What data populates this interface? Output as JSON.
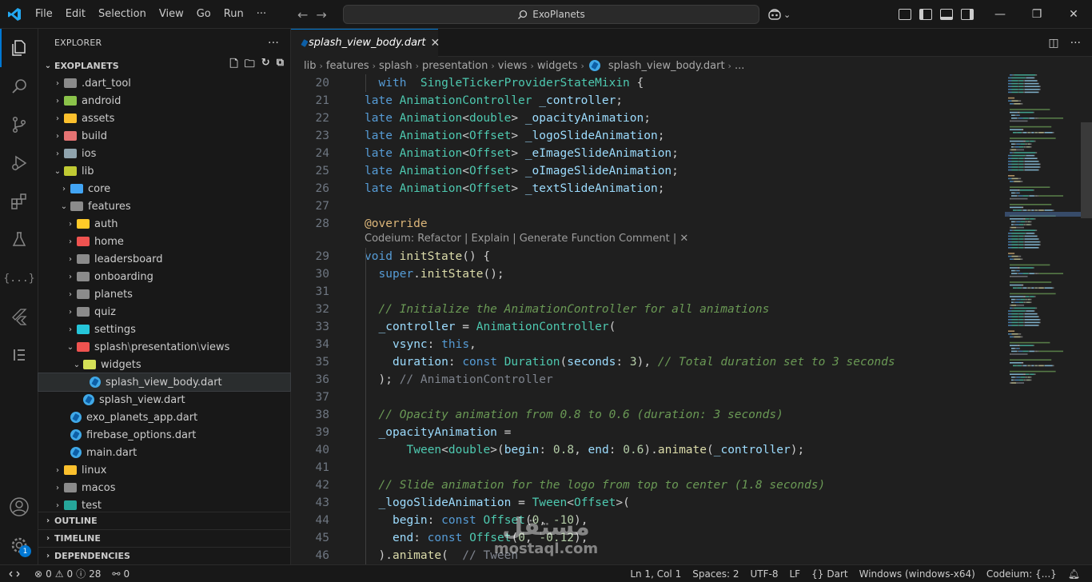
{
  "titlebar": {
    "menu": [
      "File",
      "Edit",
      "Selection",
      "View",
      "Go",
      "Run",
      "···"
    ],
    "search_text": "ExoPlanets"
  },
  "sidebar": {
    "title": "EXPLORER",
    "more": "···",
    "project": "EXOPLANETS",
    "tree": [
      {
        "label": "dart_tool",
        "prefix": ".",
        "depth": 0,
        "kind": "folder",
        "open": false,
        "color": "#8b8b8b",
        "name": "tree-folder-dart-tool"
      },
      {
        "label": "android",
        "depth": 0,
        "kind": "folder",
        "open": false,
        "color": "#8bc34a",
        "name": "tree-folder-android"
      },
      {
        "label": "assets",
        "depth": 0,
        "kind": "folder",
        "open": false,
        "color": "#fbc02d",
        "name": "tree-folder-assets"
      },
      {
        "label": "build",
        "depth": 0,
        "kind": "folder",
        "open": false,
        "color": "#e57373",
        "name": "tree-folder-build"
      },
      {
        "label": "ios",
        "depth": 0,
        "kind": "folder",
        "open": false,
        "color": "#90a4ae",
        "name": "tree-folder-ios"
      },
      {
        "label": "lib",
        "depth": 0,
        "kind": "folder",
        "open": true,
        "color": "#c0ca33",
        "name": "tree-folder-lib"
      },
      {
        "label": "core",
        "depth": 1,
        "kind": "folder",
        "open": false,
        "color": "#42a5f5",
        "name": "tree-folder-core"
      },
      {
        "label": "features",
        "depth": 1,
        "kind": "folder",
        "open": true,
        "color": "#8b8b8b",
        "name": "tree-folder-features"
      },
      {
        "label": "auth",
        "depth": 2,
        "kind": "folder",
        "open": false,
        "color": "#ffca28",
        "name": "tree-folder-auth"
      },
      {
        "label": "home",
        "depth": 2,
        "kind": "folder",
        "open": false,
        "color": "#ef5350",
        "name": "tree-folder-home"
      },
      {
        "label": "leadersboard",
        "depth": 2,
        "kind": "folder",
        "open": false,
        "color": "#8b8b8b",
        "name": "tree-folder-leadersboard"
      },
      {
        "label": "onboarding",
        "depth": 2,
        "kind": "folder",
        "open": false,
        "color": "#8b8b8b",
        "name": "tree-folder-onboarding"
      },
      {
        "label": "planets",
        "depth": 2,
        "kind": "folder",
        "open": false,
        "color": "#8b8b8b",
        "name": "tree-folder-planets"
      },
      {
        "label": "quiz",
        "depth": 2,
        "kind": "folder",
        "open": false,
        "color": "#8b8b8b",
        "name": "tree-folder-quiz"
      },
      {
        "label": "settings",
        "depth": 2,
        "kind": "folder",
        "open": false,
        "color": "#26c6da",
        "name": "tree-folder-settings"
      },
      {
        "label": "splash",
        "depth": 2,
        "kind": "folder",
        "open": true,
        "color": "#ef5350",
        "compact": [
          "presentation",
          "views"
        ],
        "name": "tree-folder-splash"
      },
      {
        "label": "widgets",
        "depth": 3,
        "kind": "folder",
        "open": true,
        "color": "#d4e157",
        "name": "tree-folder-widgets"
      },
      {
        "label": "splash_view_body.dart",
        "depth": 4,
        "kind": "dart",
        "selected": true,
        "name": "tree-file-splash-view-body"
      },
      {
        "label": "splash_view.dart",
        "depth": 3,
        "kind": "dart",
        "name": "tree-file-splash-view"
      },
      {
        "label": "exo_planets_app.dart",
        "depth": 1,
        "kind": "dart",
        "name": "tree-file-exo-planets-app"
      },
      {
        "label": "firebase_options.dart",
        "depth": 1,
        "kind": "dart",
        "name": "tree-file-firebase-options"
      },
      {
        "label": "main.dart",
        "depth": 1,
        "kind": "dart",
        "name": "tree-file-main"
      },
      {
        "label": "linux",
        "depth": 0,
        "kind": "folder",
        "open": false,
        "color": "#fbc02d",
        "name": "tree-folder-linux"
      },
      {
        "label": "macos",
        "depth": 0,
        "kind": "folder",
        "open": false,
        "color": "#8b8b8b",
        "name": "tree-folder-macos"
      },
      {
        "label": "test",
        "depth": 0,
        "kind": "folder",
        "open": false,
        "color": "#26a69a",
        "name": "tree-folder-test"
      }
    ],
    "sections": [
      "OUTLINE",
      "TIMELINE",
      "DEPENDENCIES"
    ]
  },
  "editor": {
    "tab": "splash_view_body.dart",
    "breadcrumb": [
      "lib",
      "features",
      "splash",
      "presentation",
      "views",
      "widgets",
      "splash_view_body.dart",
      "..."
    ],
    "codelens": "Codeium: Refactor | Explain | Generate Function Comment | ✕",
    "lines": [
      {
        "n": "20",
        "i": 1,
        "t": [
          [
            "kw",
            "with"
          ],
          [
            "",
            "  "
          ],
          [
            "ty",
            "SingleTickerProviderStateMixin"
          ],
          [
            "",
            " {"
          ]
        ]
      },
      {
        "n": "21",
        "i": 0,
        "t": [
          [
            "kw",
            "late "
          ],
          [
            "ty",
            "AnimationController"
          ],
          [
            "",
            " "
          ],
          [
            "va",
            "_controller"
          ],
          [
            "",
            ";"
          ]
        ]
      },
      {
        "n": "22",
        "i": 0,
        "t": [
          [
            "kw",
            "late "
          ],
          [
            "ty",
            "Animation"
          ],
          [
            "",
            "<"
          ],
          [
            "ty",
            "double"
          ],
          [
            "",
            "> "
          ],
          [
            "va",
            "_opacityAnimation"
          ],
          [
            "",
            ";"
          ]
        ]
      },
      {
        "n": "23",
        "i": 0,
        "t": [
          [
            "kw",
            "late "
          ],
          [
            "ty",
            "Animation"
          ],
          [
            "",
            "<"
          ],
          [
            "ty",
            "Offset"
          ],
          [
            "",
            "> "
          ],
          [
            "va",
            "_logoSlideAnimation"
          ],
          [
            "",
            ";"
          ]
        ]
      },
      {
        "n": "24",
        "i": 0,
        "t": [
          [
            "kw",
            "late "
          ],
          [
            "ty",
            "Animation"
          ],
          [
            "",
            "<"
          ],
          [
            "ty",
            "Offset"
          ],
          [
            "",
            "> "
          ],
          [
            "va",
            "_eImageSlideAnimation"
          ],
          [
            "",
            ";"
          ]
        ]
      },
      {
        "n": "25",
        "i": 0,
        "t": [
          [
            "kw",
            "late "
          ],
          [
            "ty",
            "Animation"
          ],
          [
            "",
            "<"
          ],
          [
            "ty",
            "Offset"
          ],
          [
            "",
            "> "
          ],
          [
            "va",
            "_oImageSlideAnimation"
          ],
          [
            "",
            ";"
          ]
        ]
      },
      {
        "n": "26",
        "i": 0,
        "t": [
          [
            "kw",
            "late "
          ],
          [
            "ty",
            "Animation"
          ],
          [
            "",
            "<"
          ],
          [
            "ty",
            "Offset"
          ],
          [
            "",
            "> "
          ],
          [
            "va",
            "_textSlideAnimation"
          ],
          [
            "",
            ";"
          ]
        ]
      },
      {
        "n": "27",
        "i": 0,
        "t": []
      },
      {
        "n": "28",
        "i": 0,
        "t": [
          [
            "an",
            "@override"
          ]
        ],
        "lens": true
      },
      {
        "n": "29",
        "i": 0,
        "t": [
          [
            "kw",
            "void "
          ],
          [
            "fn",
            "initState"
          ],
          [
            "",
            "() {"
          ]
        ]
      },
      {
        "n": "30",
        "i": 1,
        "t": [
          [
            "kw",
            "super"
          ],
          [
            "",
            "."
          ],
          [
            "fn",
            "initState"
          ],
          [
            "",
            "();"
          ]
        ]
      },
      {
        "n": "31",
        "i": 1,
        "t": []
      },
      {
        "n": "32",
        "i": 1,
        "t": [
          [
            "cm",
            "// Initialize the AnimationController for all animations"
          ]
        ]
      },
      {
        "n": "33",
        "i": 1,
        "t": [
          [
            "va",
            "_controller"
          ],
          [
            "op",
            " = "
          ],
          [
            "ty",
            "AnimationController"
          ],
          [
            "",
            "("
          ]
        ]
      },
      {
        "n": "34",
        "i": 2,
        "t": [
          [
            "va",
            "vsync"
          ],
          [
            "",
            ": "
          ],
          [
            "kw",
            "this"
          ],
          [
            "",
            ","
          ]
        ]
      },
      {
        "n": "35",
        "i": 2,
        "t": [
          [
            "va",
            "duration"
          ],
          [
            "",
            ": "
          ],
          [
            "kw",
            "const "
          ],
          [
            "ty",
            "Duration"
          ],
          [
            "",
            "("
          ],
          [
            "va",
            "seconds"
          ],
          [
            "",
            ": "
          ],
          [
            "nu",
            "3"
          ],
          [
            "",
            "), "
          ],
          [
            "cm",
            "// Total duration set to 3 seconds"
          ]
        ]
      },
      {
        "n": "36",
        "i": 1,
        "t": [
          [
            "",
            "); "
          ],
          [
            "ci",
            "// AnimationController"
          ]
        ]
      },
      {
        "n": "37",
        "i": 1,
        "t": []
      },
      {
        "n": "38",
        "i": 1,
        "t": [
          [
            "cm",
            "// Opacity animation from 0.8 to 0.6 (duration: 3 seconds)"
          ]
        ]
      },
      {
        "n": "39",
        "i": 1,
        "t": [
          [
            "va",
            "_opacityAnimation"
          ],
          [
            "op",
            " ="
          ]
        ]
      },
      {
        "n": "40",
        "i": 3,
        "t": [
          [
            "ty",
            "Tween"
          ],
          [
            "",
            "<"
          ],
          [
            "ty",
            "double"
          ],
          [
            "",
            ">("
          ],
          [
            "va",
            "begin"
          ],
          [
            "",
            ": "
          ],
          [
            "nu",
            "0.8"
          ],
          [
            "",
            ", "
          ],
          [
            "va",
            "end"
          ],
          [
            "",
            ": "
          ],
          [
            "nu",
            "0.6"
          ],
          [
            "",
            ")."
          ],
          [
            "fn",
            "animate"
          ],
          [
            "",
            "("
          ],
          [
            "va",
            "_controller"
          ],
          [
            "",
            ");"
          ]
        ]
      },
      {
        "n": "41",
        "i": 1,
        "t": []
      },
      {
        "n": "42",
        "i": 1,
        "t": [
          [
            "cm",
            "// Slide animation for the logo from top to center (1.8 seconds)"
          ]
        ]
      },
      {
        "n": "43",
        "i": 1,
        "t": [
          [
            "va",
            "_logoSlideAnimation"
          ],
          [
            "op",
            " = "
          ],
          [
            "ty",
            "Tween"
          ],
          [
            "",
            "<"
          ],
          [
            "ty",
            "Offset"
          ],
          [
            "",
            ">("
          ]
        ]
      },
      {
        "n": "44",
        "i": 2,
        "t": [
          [
            "va",
            "begin"
          ],
          [
            "",
            ": "
          ],
          [
            "kw",
            "const "
          ],
          [
            "ty",
            "Offset"
          ],
          [
            "",
            "("
          ],
          [
            "nu",
            "0"
          ],
          [
            "",
            ", "
          ],
          [
            "nu",
            "-10"
          ],
          [
            "",
            "),"
          ]
        ]
      },
      {
        "n": "45",
        "i": 2,
        "t": [
          [
            "va",
            "end"
          ],
          [
            "",
            ": "
          ],
          [
            "kw",
            "const "
          ],
          [
            "ty",
            "Offset"
          ],
          [
            "",
            "("
          ],
          [
            "nu",
            "0"
          ],
          [
            "",
            ", "
          ],
          [
            "nu",
            "-0.12"
          ],
          [
            "",
            "),"
          ]
        ]
      },
      {
        "n": "46",
        "i": 1,
        "t": [
          [
            "",
            ")."
          ],
          [
            "fn",
            "animate"
          ],
          [
            "",
            "(  "
          ],
          [
            "ci",
            "// Tween"
          ]
        ]
      }
    ]
  },
  "statusbar": {
    "errors": "0",
    "warnings": "0",
    "info": "28",
    "ports": "0",
    "position": "Ln 1, Col 1",
    "spaces": "Spaces: 2",
    "encoding": "UTF-8",
    "eol": "LF",
    "language": "Dart",
    "platform": "Windows (windows-x64)",
    "codeium": "Codeium: {...}"
  },
  "watermark": {
    "ar": "مستقل",
    "en": "mostaql.com"
  },
  "colors": {
    "accent": "#0078d4",
    "background": "#1f1f1f",
    "sidebar": "#181818"
  }
}
